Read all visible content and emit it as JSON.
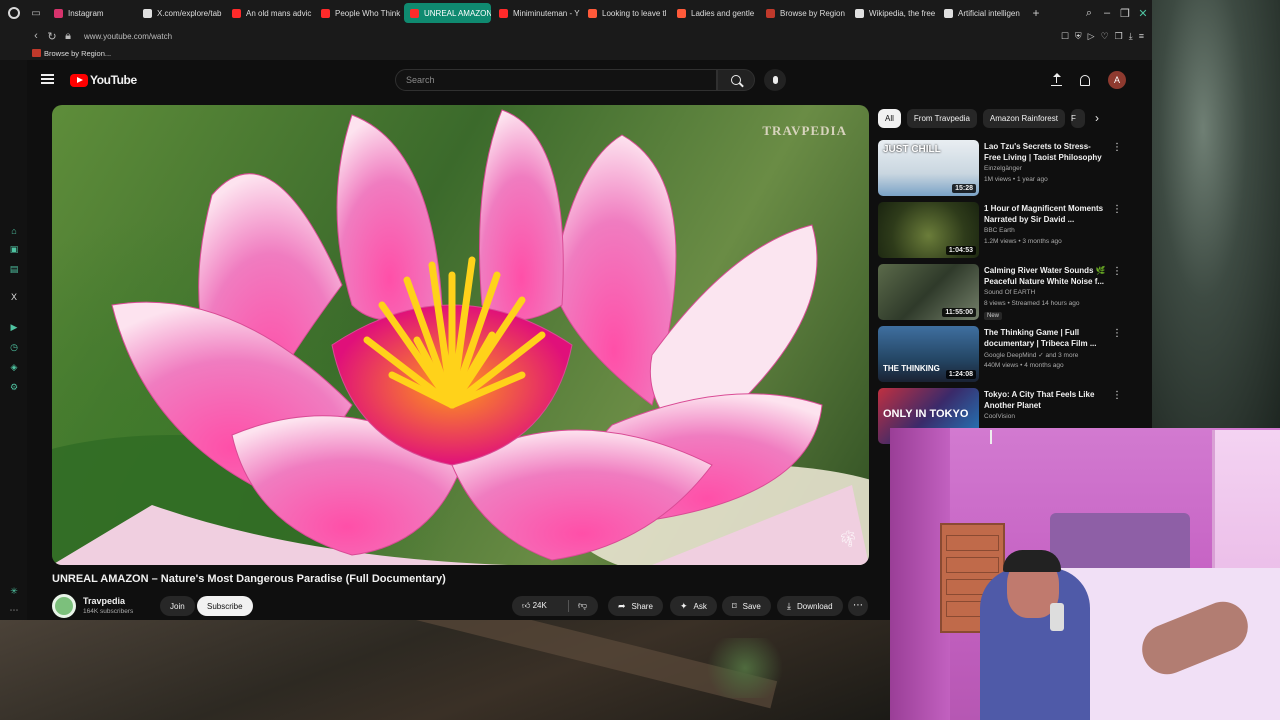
{
  "browser": {
    "tabs": [
      {
        "label": "Instagram",
        "color": "#d6336c"
      },
      {
        "label": "X.com/explore/tab",
        "color": "#e0e0e0"
      },
      {
        "label": "An old mans advic",
        "color": "#ff2a2a"
      },
      {
        "label": "People Who Think",
        "color": "#ff2a2a"
      },
      {
        "label": "UNREAL AMAZON – N",
        "color": "#ff2a2a",
        "active": true
      },
      {
        "label": "Miniminuteman - Y",
        "color": "#ff2a2a"
      },
      {
        "label": "Looking to leave tl",
        "color": "#ff5a3a"
      },
      {
        "label": "Ladies and gentle",
        "color": "#ff5a3a"
      },
      {
        "label": "Browse by Region",
        "color": "#c0392b"
      },
      {
        "label": "Wikipedia, the free",
        "color": "#e0e0e0"
      },
      {
        "label": "Artificial intelligen",
        "color": "#e0e0e0"
      }
    ],
    "url": "www.youtube.com/watch",
    "bookmark": "Browse by Region..."
  },
  "youtube": {
    "logo_text": "YouTube",
    "search_placeholder": "Search",
    "avatar_letter": "A",
    "video": {
      "watermark": "TRAVPEDIA",
      "title": "UNREAL AMAZON – Nature's Most Dangerous Paradise (Full Documentary)",
      "channel": "Travpedia",
      "subscribers": "164K subscribers",
      "join_label": "Join",
      "subscribe_label": "Subscribe",
      "likes": "24K",
      "share_label": "Share",
      "ask_label": "Ask",
      "save_label": "Save",
      "download_label": "Download"
    },
    "chips": [
      "All",
      "From Travpedia",
      "Amazon Rainforest",
      "F"
    ],
    "recommendations": [
      {
        "title": "Lao Tzu's Secrets to Stress-Free Living | Taoist Philosophy",
        "channel": "Einzelgänger",
        "meta": "1M views • 1 year ago",
        "duration": "15:28",
        "thumb_text": "JUST CHILL",
        "new": ""
      },
      {
        "title": "1 Hour of Magnificent Moments Narrated by Sir David ...",
        "channel": "BBC Earth",
        "meta": "1.2M views • 3 months ago",
        "duration": "1:04:53",
        "thumb_text": "",
        "new": ""
      },
      {
        "title": "Calming River Water Sounds 🌿 Peaceful Nature White Noise f...",
        "channel": "Sound Of EARTH",
        "meta": "8 views • Streamed 14 hours ago",
        "duration": "11:55:00",
        "thumb_text": "",
        "new": "New"
      },
      {
        "title": "The Thinking Game | Full documentary | Tribeca Film ...",
        "channel": "Google DeepMind ✓ and 3 more",
        "meta": "440M views • 4 months ago",
        "duration": "1:24:08",
        "thumb_text": "THE THINKING",
        "new": ""
      },
      {
        "title": "Tokyo: A City That Feels Like Another Planet",
        "channel": "CoolVision",
        "meta": "",
        "duration": "",
        "thumb_text": "ONLY IN TOKYO",
        "new": ""
      }
    ]
  }
}
